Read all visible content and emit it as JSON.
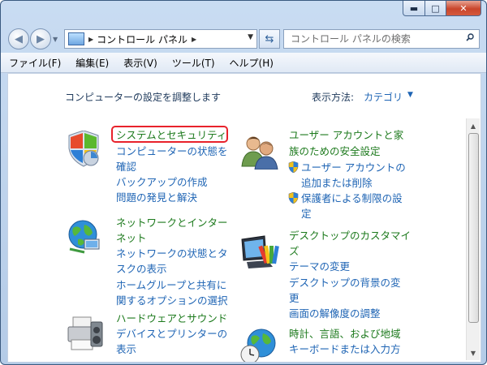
{
  "window": {
    "buttons": {
      "minimize": "▬",
      "maximize": "□",
      "close": "✕"
    }
  },
  "address": {
    "crumb": "コントロール パネル",
    "search_placeholder": "コントロール パネルの検索"
  },
  "menu": [
    "ファイル(F)",
    "編集(E)",
    "表示(V)",
    "ツール(T)",
    "ヘルプ(H)"
  ],
  "content": {
    "heading": "コンピューターの設定を調整します",
    "view_by_label": "表示方法:",
    "view_by_value": "カテゴリ"
  },
  "categories": {
    "system": {
      "title": "システムとセキュリティ",
      "tasks": [
        "コンピューターの状態を",
        "確認",
        "バックアップの作成",
        "問題の発見と解決"
      ]
    },
    "network": {
      "title_lines": [
        "ネットワークとインター",
        "ネット"
      ],
      "tasks": [
        "ネットワークの状態とタ",
        "スクの表示",
        "ホームグループと共有に",
        "関するオプションの選択"
      ]
    },
    "hardware": {
      "title": "ハードウェアとサウンド",
      "tasks": [
        "デバイスとプリンターの",
        "表示"
      ]
    },
    "users": {
      "title_lines": [
        "ユーザー アカウントと家",
        "族のための安全設定"
      ],
      "tasks": [
        "ユーザー アカウントの",
        "追加または削除",
        "保護者による制限の設",
        "定"
      ]
    },
    "appearance": {
      "title_lines": [
        "デスクトップのカスタマイ",
        "ズ"
      ],
      "tasks": [
        "テーマの変更",
        "デスクトップの背景の変",
        "更",
        "画面の解像度の調整"
      ]
    },
    "clock": {
      "title": "時計、言語、および地域",
      "tasks": [
        "キーボードまたは入力方"
      ]
    }
  },
  "colors": {
    "category_title": "#1d7a1d",
    "task_link": "#1e64b4",
    "highlight": "#e8222b"
  }
}
